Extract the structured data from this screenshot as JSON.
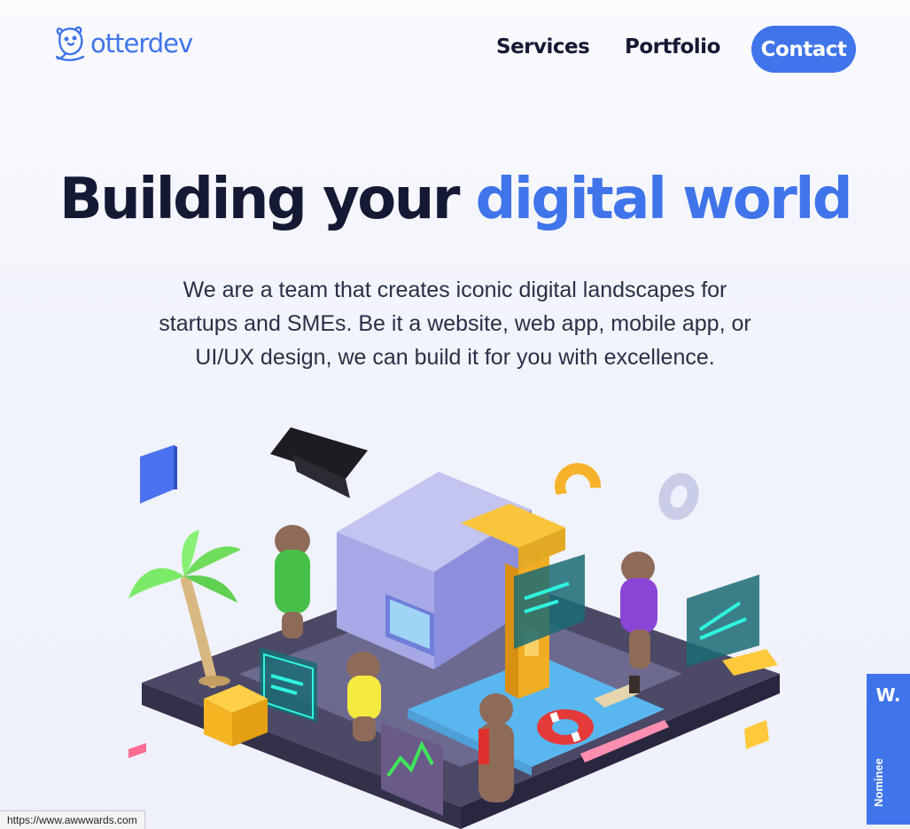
{
  "header": {
    "logo_text": "otterdev",
    "nav": {
      "services": "Services",
      "portfolio": "Portfolio",
      "contact": "Contact"
    }
  },
  "hero": {
    "title_main": "Building your ",
    "title_accent": "digital world",
    "subtitle": "We are a team that creates iconic digital landscapes for startups and SMEs. Be it a website, web app, mobile app, or UI/UX design, we can build it for you with excellence."
  },
  "badge": {
    "logo": "W.",
    "label": "Nominee"
  },
  "status_bar": {
    "url": "https://www.awwwards.com"
  },
  "colors": {
    "accent": "#3f74ea",
    "text_dark": "#141a33",
    "background": "#f2f4fc"
  },
  "icons": [
    "otter-logo-icon",
    "awwwards-w-icon"
  ]
}
